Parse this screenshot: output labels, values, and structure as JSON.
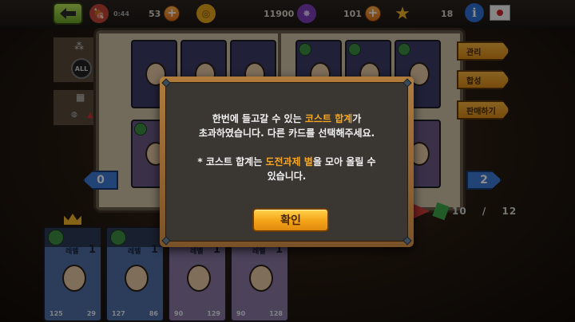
{
  "topbar": {
    "meat_value": "0:44",
    "stamina_value": "53",
    "gold_value": "11900",
    "gem_value": "101",
    "star_value": "18",
    "info_label": "i"
  },
  "sidebar": {
    "filter_all_label": "ALL"
  },
  "side_tabs": {
    "manage_label": "관리",
    "synthesize_label": "합성",
    "sell_label": "판매하기"
  },
  "pagination": {
    "prev_label": "0",
    "next_label": "2",
    "deck_count": "10",
    "deck_max": "12",
    "separator": "/"
  },
  "deck": {
    "level_label": "레벨",
    "cards": [
      {
        "level": "1",
        "stat_left": "125",
        "stat_right": "29",
        "color": "blue"
      },
      {
        "level": "1",
        "stat_left": "127",
        "stat_right": "86",
        "color": "blue"
      },
      {
        "level": "1",
        "stat_left": "90",
        "stat_right": "129",
        "color": "purple"
      },
      {
        "level": "1",
        "stat_left": "90",
        "stat_right": "128",
        "color": "purple"
      }
    ]
  },
  "modal": {
    "line1_pre": "한번에 들고갈 수 있는 ",
    "line1_hl": "코스트 합계",
    "line1_post": "가",
    "line2": "초과하였습니다. 다른 카드를 선택해주세요.",
    "line3_pre": "* 코스트 합계는 ",
    "line3_hl1": "도전과제 별",
    "line3_mid": "을 모아 올릴 수",
    "line4": "있습니다.",
    "confirm_label": "확인"
  },
  "colors": {
    "highlight": "#f5a623",
    "confirm_button": "#f4a317",
    "modal_frame": "#b07c3d",
    "modal_body": "#3a3632"
  }
}
